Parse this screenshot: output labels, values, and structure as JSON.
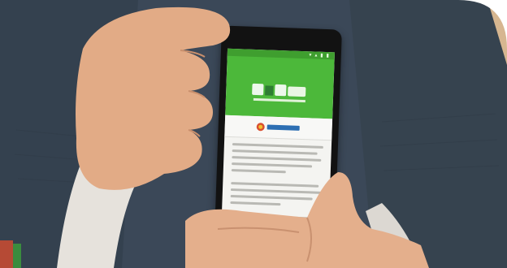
{
  "photo": {
    "description_colors": {
      "sweater": "#3c4a5c",
      "skin": "#e8b08e",
      "phone": "#121212",
      "app_green": "#4cb83a",
      "screen_bg": "#f4f4f1",
      "wall": "#c9a888"
    }
  },
  "phone": {
    "app_header_color": "#4cb83a",
    "status_icons": "▾ ▴ ▮ ▮",
    "body_line_groups": [
      5,
      4,
      3
    ]
  }
}
